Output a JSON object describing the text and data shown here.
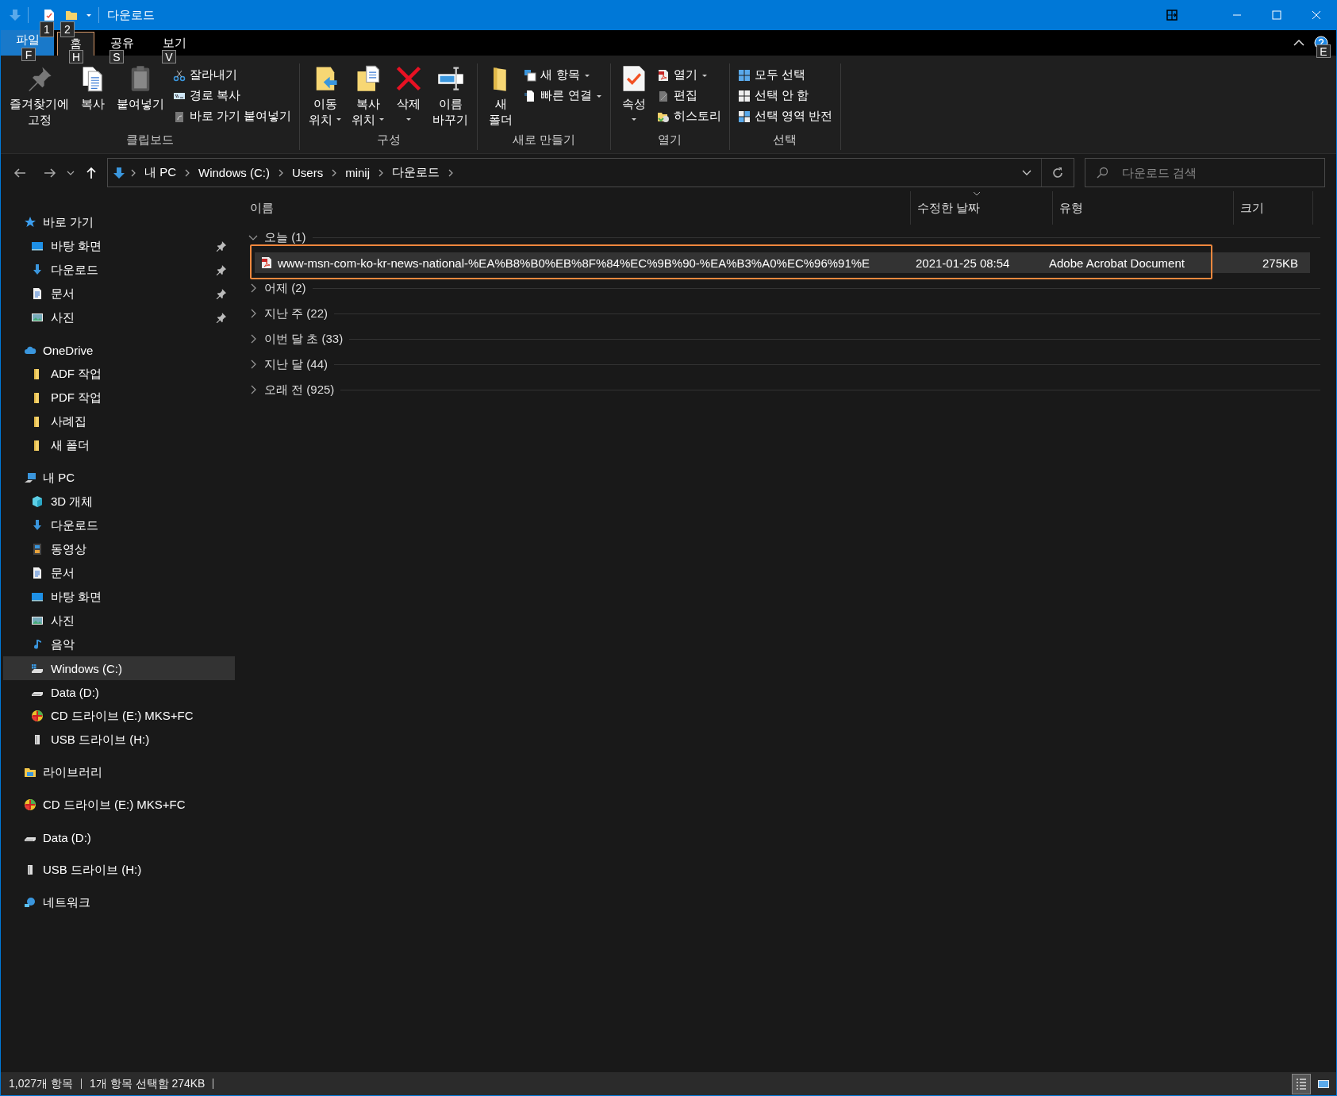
{
  "window": {
    "title": "다운로드",
    "quick_access_keytips": [
      "1",
      "2"
    ],
    "help_keytip": "E"
  },
  "ribbon_tabs": [
    {
      "label": "파일",
      "keytip": "F",
      "selected": false,
      "kind": "backstage"
    },
    {
      "label": "홈",
      "keytip": "H",
      "selected": true,
      "kind": "tab"
    },
    {
      "label": "공유",
      "keytip": "S",
      "selected": false,
      "kind": "tab"
    },
    {
      "label": "보기",
      "keytip": "V",
      "selected": false,
      "kind": "tab"
    }
  ],
  "ribbon_groups": [
    {
      "label": "클립보드",
      "commands": [
        {
          "label": "즐겨찾기에\n고정",
          "kind": "large",
          "dropdown": false
        },
        {
          "label": "복사",
          "kind": "large",
          "dropdown": false
        },
        {
          "label": "붙여넣기",
          "kind": "large",
          "dropdown": false
        },
        {
          "label": "잘라내기",
          "kind": "small",
          "dropdown": false
        },
        {
          "label": "경로 복사",
          "kind": "small",
          "dropdown": false
        },
        {
          "label": "바로 가기 붙여넣기",
          "kind": "small",
          "dropdown": false
        }
      ]
    },
    {
      "label": "구성",
      "commands": [
        {
          "label": "이동\n위치",
          "kind": "large",
          "dropdown": true
        },
        {
          "label": "복사\n위치",
          "kind": "large",
          "dropdown": true
        },
        {
          "label": "삭제",
          "kind": "large",
          "dropdown": true
        },
        {
          "label": "이름\n바꾸기",
          "kind": "large",
          "dropdown": false
        }
      ]
    },
    {
      "label": "새로 만들기",
      "commands": [
        {
          "label": "새\n폴더",
          "kind": "large",
          "dropdown": false
        },
        {
          "label": "새 항목",
          "kind": "small",
          "dropdown": true
        },
        {
          "label": "빠른 연결",
          "kind": "small",
          "dropdown": true
        }
      ]
    },
    {
      "label": "열기",
      "commands": [
        {
          "label": "속성",
          "kind": "large",
          "dropdown": true
        },
        {
          "label": "열기",
          "kind": "small",
          "dropdown": true
        },
        {
          "label": "편집",
          "kind": "small",
          "dropdown": false
        },
        {
          "label": "히스토리",
          "kind": "small",
          "dropdown": false
        }
      ]
    },
    {
      "label": "선택",
      "commands": [
        {
          "label": "모두 선택",
          "kind": "small",
          "dropdown": false
        },
        {
          "label": "선택 안 함",
          "kind": "small",
          "dropdown": false
        },
        {
          "label": "선택 영역 반전",
          "kind": "small",
          "dropdown": false
        }
      ]
    }
  ],
  "address_bar": {
    "path": [
      "내 PC",
      "Windows (C:)",
      "Users",
      "minij",
      "다운로드"
    ]
  },
  "search": {
    "placeholder": "다운로드 검색"
  },
  "navigation_pane": {
    "items": [
      {
        "label": "바로 가기",
        "kind": "star",
        "selected": false,
        "children": [
          {
            "label": "바탕 화면",
            "kind": "desktop",
            "selected": false,
            "pinned": true
          },
          {
            "label": "다운로드",
            "kind": "download",
            "selected": false,
            "pinned": true
          },
          {
            "label": "문서",
            "kind": "document",
            "selected": false,
            "pinned": true
          },
          {
            "label": "사진",
            "kind": "pictures",
            "selected": false,
            "pinned": true
          }
        ]
      },
      {
        "label": "OneDrive",
        "kind": "cloud",
        "selected": false,
        "children": [
          {
            "label": "ADF 작업",
            "kind": "folder",
            "selected": false,
            "pinned": false
          },
          {
            "label": "PDF 작업",
            "kind": "folder",
            "selected": false,
            "pinned": false
          },
          {
            "label": "사례집",
            "kind": "folder",
            "selected": false,
            "pinned": false
          },
          {
            "label": "새 폴더",
            "kind": "folder",
            "selected": false,
            "pinned": false
          }
        ]
      },
      {
        "label": "내 PC",
        "kind": "pc",
        "selected": false,
        "children": [
          {
            "label": "3D 개체",
            "kind": "cube",
            "selected": false,
            "pinned": false
          },
          {
            "label": "다운로드",
            "kind": "download",
            "selected": false,
            "pinned": false
          },
          {
            "label": "동영상",
            "kind": "video",
            "selected": false,
            "pinned": false
          },
          {
            "label": "문서",
            "kind": "document",
            "selected": false,
            "pinned": false
          },
          {
            "label": "바탕 화면",
            "kind": "desktop",
            "selected": false,
            "pinned": false
          },
          {
            "label": "사진",
            "kind": "pictures",
            "selected": false,
            "pinned": false
          },
          {
            "label": "음악",
            "kind": "music",
            "selected": false,
            "pinned": false
          },
          {
            "label": "Windows (C:)",
            "kind": "system-drive",
            "selected": true,
            "pinned": false
          },
          {
            "label": "Data (D:)",
            "kind": "drive",
            "selected": false,
            "pinned": false
          },
          {
            "label": "CD 드라이브 (E:) MKS+FC",
            "kind": "cd",
            "selected": false,
            "pinned": false
          },
          {
            "label": "USB 드라이브 (H:)",
            "kind": "usb",
            "selected": false,
            "pinned": false
          }
        ]
      },
      {
        "label": "라이브러리",
        "kind": "library",
        "selected": false
      },
      {
        "label": "CD 드라이브 (E:) MKS+FC",
        "kind": "cd",
        "selected": false
      },
      {
        "label": "Data (D:)",
        "kind": "drive",
        "selected": false
      },
      {
        "label": "USB 드라이브 (H:)",
        "kind": "usb",
        "selected": false
      },
      {
        "label": "네트워크",
        "kind": "network",
        "selected": false
      }
    ]
  },
  "file_list": {
    "columns": [
      {
        "label": "이름",
        "sorted": false
      },
      {
        "label": "수정한 날짜",
        "sorted": true
      },
      {
        "label": "유형",
        "sorted": false
      },
      {
        "label": "크기",
        "sorted": false
      }
    ],
    "groups": [
      {
        "label": "오늘 (1)",
        "expanded": true,
        "files": [
          {
            "name": "www-msn-com-ko-kr-news-national-%EA%B8%B0%EB%8F%84%EC%9B%90-%EA%B3%A0%EC%96%91%E",
            "modified": "2021-01-25 08:54",
            "type": "Adobe Acrobat Document",
            "size": "275KB",
            "kind": "pdf",
            "selected": true,
            "highlighted": true
          }
        ]
      },
      {
        "label": "어제 (2)",
        "expanded": false
      },
      {
        "label": "지난 주 (22)",
        "expanded": false
      },
      {
        "label": "이번 달 초 (33)",
        "expanded": false
      },
      {
        "label": "지난 달 (44)",
        "expanded": false
      },
      {
        "label": "오래 전 (925)",
        "expanded": false
      }
    ]
  },
  "status_bar": {
    "item_count": "1,027개 항목",
    "selection": "1개 항목 선택함 274KB",
    "view_buttons": [
      {
        "selected": true
      },
      {
        "selected": false
      }
    ]
  }
}
